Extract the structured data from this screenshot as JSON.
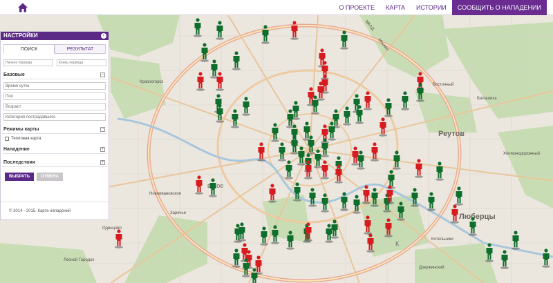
{
  "nav": {
    "home_icon": "home-icon",
    "items": [
      {
        "label": "О ПРОЕКТЕ"
      },
      {
        "label": "КАРТА"
      },
      {
        "label": "ИСТОРИИ"
      },
      {
        "label": "СООБЩИТЬ О НАПАДЕНИИ"
      }
    ]
  },
  "colors": {
    "brand": "#6a2c91",
    "marker_green": "#0f6e2c",
    "marker_red": "#d71c20"
  },
  "panel": {
    "title": "НАСТРОЙКИ",
    "tabs": [
      "ПОИСК",
      "РЕЗУЛЬТАТ"
    ],
    "date_from_placeholder": "Начало периода",
    "date_to_placeholder": "Конец периода",
    "section_basic": "Базовые",
    "fields": [
      "Время суток",
      "Пол",
      "Возраст",
      "Категория пострадавшего"
    ],
    "section_mode": "Режимы карты",
    "heatmap_label": "Тепловая карта",
    "section_attack": "Нападение",
    "section_consequences": "Последствия",
    "btn_select": "ВЫБРАТЬ",
    "btn_cancel": "ОТМЕНА",
    "footer": "© 2014 - 2015. Карта нападений"
  },
  "map_labels": {
    "reutov": "Реутов",
    "lyubertsy": "Люберцы",
    "vskoe": "вское",
    "k": "К",
    "krasnogorsk": "Красногорск",
    "vostochny": "Восточный",
    "balashikha": "Балашиха",
    "zheleznodorozhny": "Железнодорожный",
    "novoivankovo": "Новоивановское",
    "zarechye": "Заречье",
    "odintsovo": "Одинцово",
    "kotelniki": "Котельники",
    "dzerzhinsky": "Дзержинский",
    "lesnoy_gorodok": "Лесной Городок",
    "mkad": "МКАД",
    "moskva": "Москва"
  }
}
